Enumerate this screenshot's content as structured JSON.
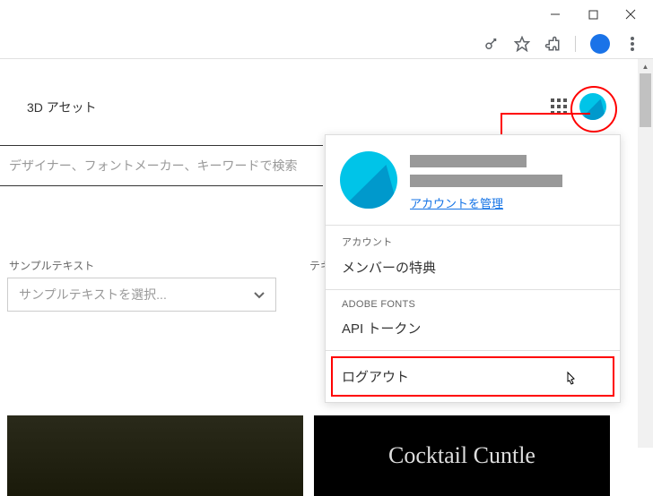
{
  "window": {
    "min": "—",
    "max": "☐",
    "close": "✕"
  },
  "nav": {
    "tab": "3D アセット"
  },
  "search": {
    "placeholder": "デザイナー、フォントメーカー、キーワードで検索"
  },
  "sample": {
    "label1": "サンプルテキスト",
    "label2": "テキ",
    "placeholder": "サンプルテキストを選択..."
  },
  "thumbs": {
    "t2": "Cocktail Cuntle"
  },
  "dropdown": {
    "manage": "アカウントを管理",
    "sec_account": "アカウント",
    "item_benefits": "メンバーの特典",
    "sec_fonts": "ADOBE FONTS",
    "item_api": "API トークン",
    "logout": "ログアウト"
  }
}
